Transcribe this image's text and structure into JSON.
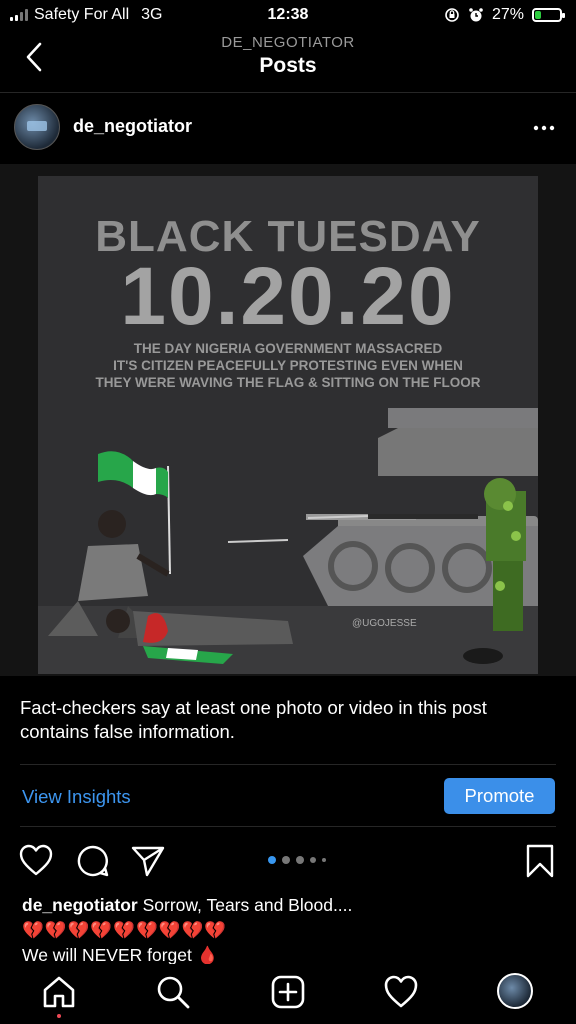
{
  "status_bar": {
    "carrier": "Safety For All",
    "network": "3G",
    "time": "12:38",
    "battery_percent": "27%",
    "battery_level": 0.27,
    "icons": [
      "signal-icon",
      "orientation-lock-icon",
      "alarm-icon",
      "battery-charging-icon"
    ]
  },
  "header": {
    "subtitle": "DE_NEGOTIATOR",
    "title": "Posts",
    "back_icon": "chevron-left-icon"
  },
  "post": {
    "username": "de_negotiator",
    "more_icon": "more-horizontal-icon",
    "image": {
      "heading": "BLACK TUESDAY",
      "date": "10.20.20",
      "lines": [
        "THE DAY NIGERIA GOVERNMENT MASSACRED",
        "IT'S CITIZEN PEACEFULLY PROTESTING EVEN WHEN",
        "THEY WERE WAVING THE FLAG & SITTING ON THE FLOOR"
      ],
      "credit": "@UGOJESSE"
    },
    "fact_check": "Fact-checkers say at least one photo or video in this post contains false information.",
    "view_insights": "View Insights",
    "promote": "Promote",
    "carousel": {
      "count": 5,
      "active": 1
    },
    "caption": {
      "username": "de_negotiator",
      "text": "Sorrow, Tears and Blood....",
      "emoji_line": "💔💔💔💔💔💔💔💔💔",
      "line3": "We will NEVER forget 🩸"
    }
  },
  "colors": {
    "accent": "#3b8fe9",
    "link": "#3d96f0",
    "background": "#000000",
    "notification": "#ed4956"
  },
  "tab_bar": {
    "icons": [
      "home-icon",
      "search-icon",
      "create-post-icon",
      "activity-heart-icon",
      "profile-avatar"
    ]
  }
}
